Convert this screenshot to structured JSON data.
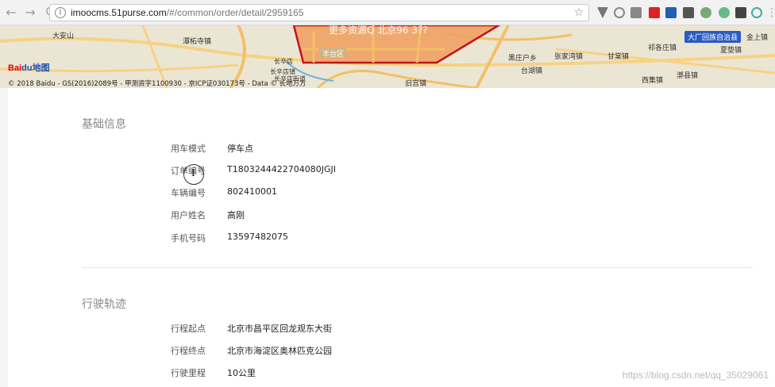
{
  "browser": {
    "back_glyph": "←",
    "forward_glyph": "→",
    "refresh_glyph": "C",
    "info_glyph": "i",
    "url_host": "imoocms.51purse.com",
    "url_path": "/#/common/order/detail/2959165",
    "star_glyph": "☆"
  },
  "map": {
    "overlay_text": "更多资源Q 北京96 3??",
    "labels": {
      "daanshan": "大安山",
      "tanzhesi": "潭柘寺镇",
      "fengtai": "丰台区",
      "changxindian": "长辛店",
      "changxindian_town": "长辛店镇",
      "changxindian_street": "长辛店街道",
      "jiugong": "旧宫镇",
      "heizhuanghu": "黑庄户乡",
      "taihu": "台湖镇",
      "zhangjiawan": "张家湾镇",
      "ganchi": "甘棠镇",
      "qifu": "祁各庄镇",
      "xiji": "西集镇",
      "yangzhuang": "漷县镇",
      "dachang_town": "夏垫镇",
      "jinshang": "金上镇"
    },
    "county_badge": "大厂回族自治县",
    "baidu_logo_red": "Bai",
    "baidu_logo_blue": "du地图",
    "copyright": "© 2018 Baidu - GS(2016)2089号 - 甲测资字1100930 - 京ICP证030173号 - Data © 长地万方"
  },
  "basic_info": {
    "title": "基础信息",
    "rows": [
      {
        "label": "用车模式",
        "value": "停车点"
      },
      {
        "label": "订单编号",
        "value": "T1803244422704080JGJI"
      },
      {
        "label": "车辆编号",
        "value": "802410001"
      },
      {
        "label": "用户姓名",
        "value": "高刚"
      },
      {
        "label": "手机号码",
        "value": "13597482075"
      }
    ]
  },
  "trip_info": {
    "title": "行驶轨迹",
    "rows": [
      {
        "label": "行程起点",
        "value": "北京市昌平区回龙观东大街"
      },
      {
        "label": "行程终点",
        "value": "北京市海淀区奥林匹克公园"
      },
      {
        "label": "行驶里程",
        "value": "10公里"
      }
    ]
  },
  "cursor_glyph": "I",
  "csdn_watermark": "https://blog.csdn.net/qq_35029061",
  "colors": {
    "map_bg": "#ece6d4",
    "district_fill": "#f0a264",
    "district_border": "#c0141c",
    "road": "#f6c35a"
  }
}
